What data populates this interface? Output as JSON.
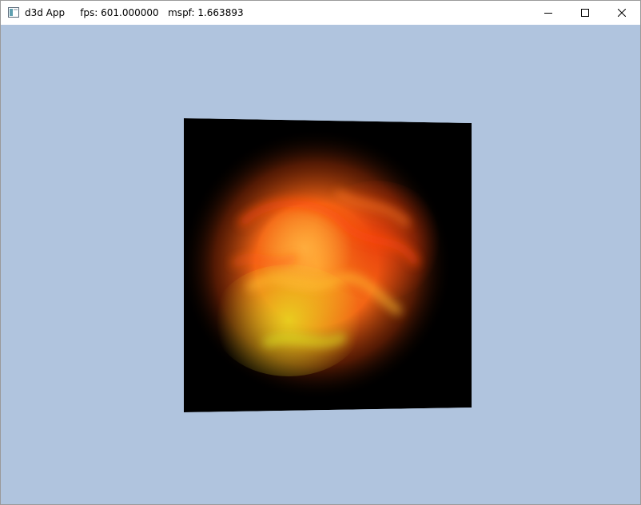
{
  "window": {
    "title": "d3d App     fps: 601.000000   mspf: 1.663893",
    "icon": "app-window-icon",
    "controls": {
      "minimize": "minimize-icon",
      "maximize": "maximize-icon",
      "close": "close-icon"
    }
  },
  "scene": {
    "background_color": "#b0c4de",
    "quad_color": "#000000",
    "fire_colors": [
      "#ff8a1e",
      "#ff5a12",
      "#e0d020",
      "#9a2a08"
    ]
  }
}
